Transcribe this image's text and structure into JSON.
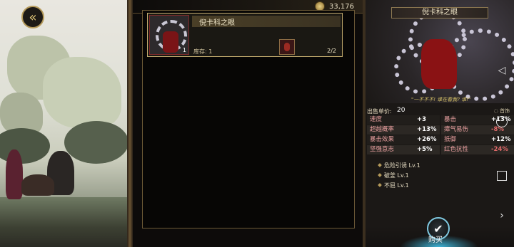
{
  "header": {
    "gold": "33,176"
  },
  "item_list": [
    {
      "name": "倪卡科之眼",
      "level": "1",
      "stock_label": "库存: 1",
      "count": "2/2"
    }
  ],
  "detail": {
    "title": "倪卡科之眼",
    "quote": "\"一不不不! 谁在看我? 谁!\"",
    "price_label": "出售单价:",
    "price_value": "20",
    "heirloom_label": "首饰",
    "stats": [
      {
        "name": "速度",
        "value": "+3"
      },
      {
        "name": "暴击",
        "value": "+13%"
      },
      {
        "name": "超越概率",
        "value": "+13%"
      },
      {
        "name": "瘴气易伤",
        "value": "-8%"
      },
      {
        "name": "暴击效果",
        "value": "+26%"
      },
      {
        "name": "抵御",
        "value": "+12%"
      },
      {
        "name": "坚强意志",
        "value": "+5%"
      },
      {
        "name": "红色抗性",
        "value": "-24%"
      }
    ],
    "skills": [
      "危险引诱 Lv.1",
      "破釜 Lv.1",
      "不屈 Lv.1"
    ],
    "buy_label": "购买"
  },
  "controls": {
    "back": "back-arrow-icon",
    "triangle": "triangle-left-icon",
    "circle": "circle-icon",
    "square": "square-icon",
    "next": "chevron-right-icon"
  },
  "colors": {
    "accent_gold": "#c6ae70",
    "negative": "#e06a6a",
    "buy_ring": "#7fc8e0"
  }
}
